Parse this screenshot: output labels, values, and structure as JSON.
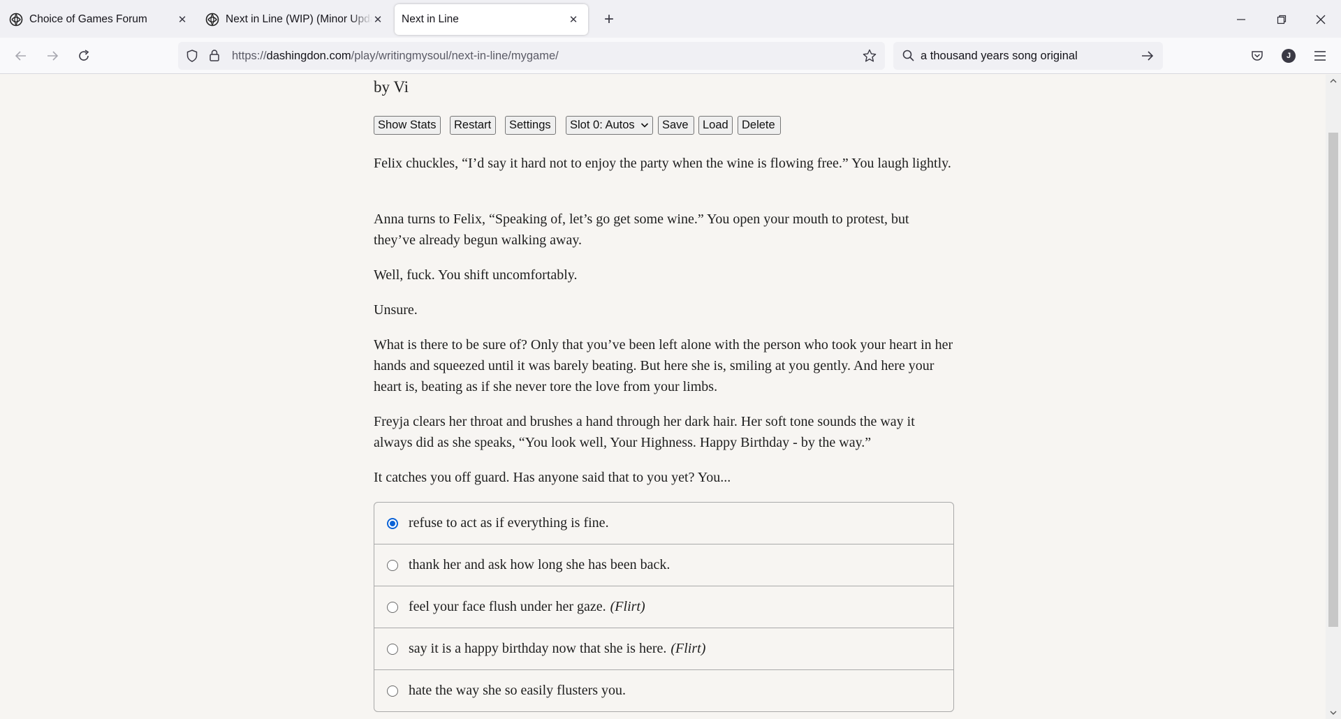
{
  "browser": {
    "tabs": [
      {
        "title": "Choice of Games Forum",
        "active": false
      },
      {
        "title": "Next in Line (WIP) (Minor Update",
        "active": false
      },
      {
        "title": "Next in Line",
        "active": true
      }
    ],
    "url_prefix": "https://",
    "url_host": "dashingdon.com",
    "url_path": "/play/writingmysoul/next-in-line/mygame/",
    "search_value": "a thousand years song original",
    "profile_initial": "J"
  },
  "game": {
    "byline": "by Vi",
    "buttons": {
      "show_stats": "Show Stats",
      "restart": "Restart",
      "settings": "Settings",
      "slot": "Slot 0: Autos",
      "save": "Save",
      "load": "Load",
      "delete": "Delete"
    },
    "paragraphs": [
      "Felix chuckles, “I’d say it hard not to enjoy the party when the wine is flowing free.” You laugh lightly.",
      "Anna turns to Felix, “Speaking of, let’s go get some wine.” You open your mouth to protest, but they’ve already begun walking away.",
      "Well, fuck. You shift uncomfortably.",
      "Unsure.",
      "What is there to be sure of? Only that you’ve been left alone with the person who took your heart in her hands and squeezed until it was barely beating. But here she is, smiling at you gently. And here your heart is, beating as if she never tore the love from your limbs.",
      "Freyja clears her throat and brushes a hand through her dark hair. Her soft tone sounds the way it always did as she speaks, “You look well, Your Highness. Happy Birthday - by the way.”",
      "It catches you off guard. Has anyone said that to you yet? You..."
    ],
    "choices": [
      {
        "text": "refuse to act as if everything is fine.",
        "tag": "",
        "selected": true
      },
      {
        "text": "thank her and ask how long she has been back.",
        "tag": "",
        "selected": false
      },
      {
        "text": "feel your face flush under her gaze.",
        "tag": "(Flirt)",
        "selected": false
      },
      {
        "text": "say it is a happy birthday now that she is here.",
        "tag": "(Flirt)",
        "selected": false
      },
      {
        "text": "hate the way she so easily flusters you.",
        "tag": "",
        "selected": false
      }
    ]
  }
}
